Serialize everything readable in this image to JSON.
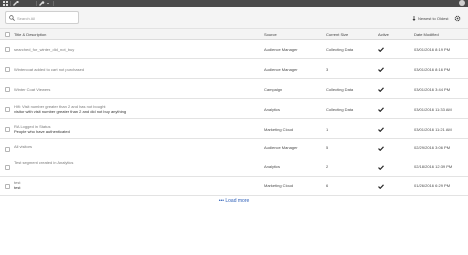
{
  "search": {
    "placeholder": "Search All"
  },
  "sort_label": "Newest to Oldest",
  "columns": {
    "title": "Title & Description",
    "source": "Source",
    "size": "Current Size",
    "active": "Active",
    "modified": "Date Modified"
  },
  "rows": [
    {
      "title": "searched_for_winter_did_not_buy",
      "desc": "",
      "source": "Audience Manager",
      "size": "Collecting Data",
      "active": true,
      "date": "03/01/2016 8:19 PM"
    },
    {
      "title": "Wintercoat added to cart not purchased",
      "desc": "",
      "source": "Audience Manager",
      "size": "3",
      "active": true,
      "date": "03/01/2016 8:16 PM"
    },
    {
      "title": "Winter Coat Viewers",
      "desc": "",
      "source": "Campaign",
      "size": "Collecting Data",
      "active": true,
      "date": "03/01/2016 3:44 PM"
    },
    {
      "title": "Hifi: Visit number greater than 2 and has not bought",
      "desc": "visitor with visit number greater than 2 and did not buy anything",
      "source": "Analytics",
      "size": "Collecting Data",
      "active": true,
      "date": "03/01/2016 11:33 AM"
    },
    {
      "title": "RA Logged in Status",
      "desc": "People who have authenticated",
      "source": "Marketing Cloud",
      "size": "1",
      "active": true,
      "date": "03/01/2016 11:21 AM"
    },
    {
      "title": "All visitors",
      "desc": "",
      "source": "Audience Manager",
      "size": "5",
      "active": true,
      "date": "02/29/2016 3:06 PM"
    },
    {
      "title": "Test segment created in Analytics",
      "desc": "",
      "source": "Analytics",
      "size": "2",
      "active": true,
      "date": "02/18/2016 12:39 PM"
    },
    {
      "title": "test",
      "desc": "test",
      "source": "Marketing Cloud",
      "size": "6",
      "active": true,
      "date": "01/26/2016 6:29 PM"
    }
  ],
  "load_more": "••• Load more",
  "colors": {
    "accent": "#2d5fb8",
    "check": "#2b2b2b",
    "topbar": "#4a4a4a"
  },
  "icons": [
    "grid-icon",
    "tools-icon",
    "wrench-icon",
    "search-icon",
    "sort-arrow-icon",
    "gear-icon",
    "help-icon",
    "checkmark-icon"
  ]
}
